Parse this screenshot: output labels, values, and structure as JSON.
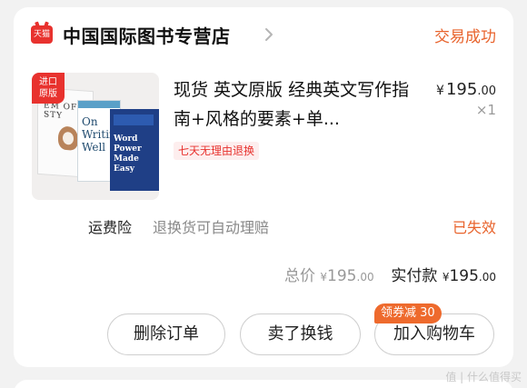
{
  "shop": {
    "badge": "天猫",
    "name": "中国国际图书专营店",
    "status": "交易成功",
    "status_color": "#e8632c"
  },
  "item": {
    "import_tag_line1": "进口",
    "import_tag_line2": "原版",
    "book1_title": "EM OF STY",
    "book2_title": "On Writing Well",
    "book3_title": "Word Power Made Easy",
    "title": "现货 英文原版 经典英文写作指南+风格的要素+单...",
    "return_policy": "七天无理由退换",
    "price_symbol": "¥",
    "price_int": "195",
    "price_dec": ".00",
    "quantity": "×1"
  },
  "insurance": {
    "label": "运费险",
    "description": "退换货可自动理赔",
    "status": "已失效"
  },
  "totals": {
    "total_label": "总价",
    "total_symbol": "¥",
    "total_int": "195",
    "total_dec": ".00",
    "paid_label": "实付款",
    "paid_symbol": "¥",
    "paid_int": "195",
    "paid_dec": ".00"
  },
  "actions": {
    "delete": "删除订单",
    "sell": "卖了换钱",
    "add_cart": "加入购物车",
    "coupon": "领券减 30"
  },
  "watermark": "值 | 什么值得买",
  "colors": {
    "accent": "#e8322e",
    "orange": "#ee6a2d"
  }
}
